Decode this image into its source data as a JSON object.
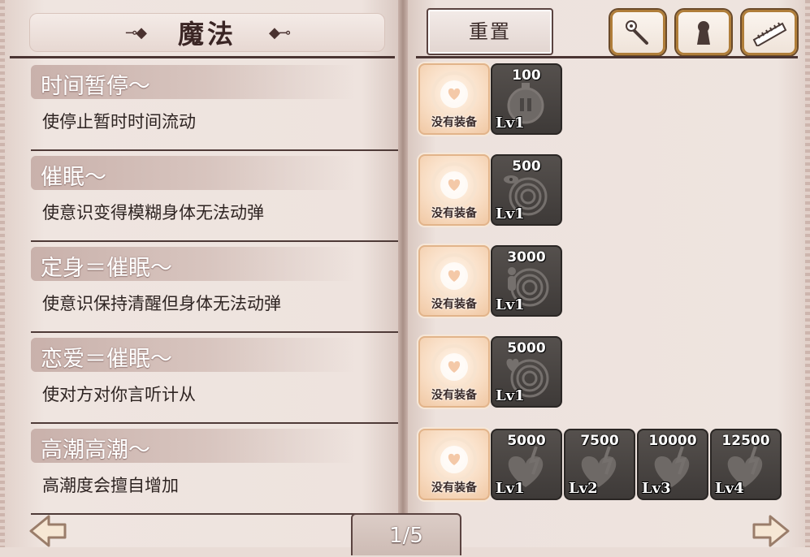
{
  "header": {
    "title": "魔法",
    "ornament_left": "⊸◆",
    "ornament_right": "◆⊸"
  },
  "toolbar": {
    "reset_label": "重置",
    "icons": [
      "wand-icon",
      "keyhole-icon",
      "ruler-icon"
    ]
  },
  "skills": [
    {
      "name": "时间暂停～",
      "desc": "使停止暂时时间流动"
    },
    {
      "name": "催眠～",
      "desc": "使意识变得模糊身体无法动弹"
    },
    {
      "name": "定身＝催眠～",
      "desc": "使意识保持清醒但身体无法动弹"
    },
    {
      "name": "恋爱＝催眠～",
      "desc": "使对方对你言听计从"
    },
    {
      "name": "高潮高潮～",
      "desc": "高潮度会擅自增加"
    }
  ],
  "slots": [
    {
      "equip_label": "没有装备",
      "levels": [
        {
          "cost": "100",
          "lv": "Lv1",
          "icon": "stopwatch-icon"
        }
      ]
    },
    {
      "equip_label": "没有装备",
      "levels": [
        {
          "cost": "500",
          "lv": "Lv1",
          "icon": "hypno-eye-icon"
        }
      ]
    },
    {
      "equip_label": "没有装备",
      "levels": [
        {
          "cost": "3000",
          "lv": "Lv1",
          "icon": "hypno-figure-icon"
        }
      ]
    },
    {
      "equip_label": "没有装备",
      "levels": [
        {
          "cost": "5000",
          "lv": "Lv1",
          "icon": "hypno-heart-icon"
        }
      ]
    },
    {
      "equip_label": "没有装备",
      "levels": [
        {
          "cost": "5000",
          "lv": "Lv1",
          "icon": "broken-heart-icon"
        },
        {
          "cost": "7500",
          "lv": "Lv2",
          "icon": "broken-heart-icon"
        },
        {
          "cost": "10000",
          "lv": "Lv3",
          "icon": "broken-heart-icon"
        },
        {
          "cost": "12500",
          "lv": "Lv4",
          "icon": "broken-heart-icon"
        }
      ]
    }
  ],
  "pager": {
    "label": "1/5"
  },
  "colors": {
    "accent": "#b07e3a",
    "rule": "#4a3432",
    "slot_dark": "#3e3a38",
    "equip_bg": "#f8dcc2"
  }
}
